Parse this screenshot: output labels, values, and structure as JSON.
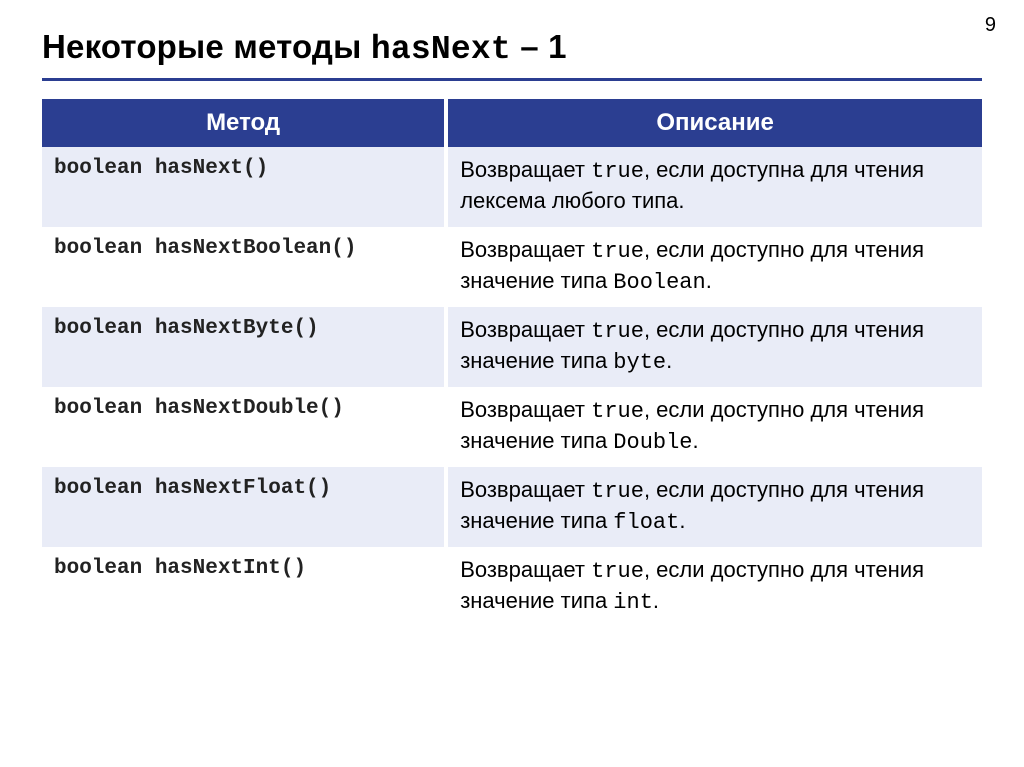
{
  "page_number": "9",
  "title_prefix": "Некоторые методы ",
  "title_code": "hasNext",
  "title_suffix": " – 1",
  "headers": {
    "method": "Метод",
    "description": "Описание"
  },
  "rows": [
    {
      "method": "boolean hasNext()",
      "desc_a": "Возвращает ",
      "desc_code1": "true",
      "desc_b": ", если доступна для чтения лексема любого типа.",
      "desc_code2": "",
      "desc_c": ""
    },
    {
      "method": "boolean hasNextBoolean()",
      "desc_a": "Возвращает ",
      "desc_code1": "true",
      "desc_b": ", если доступно для чтения значение типа ",
      "desc_code2": "Boolean",
      "desc_c": "."
    },
    {
      "method": "boolean hasNextByte()",
      "desc_a": "Возвращает ",
      "desc_code1": "true",
      "desc_b": ", если доступно для чтения значение типа ",
      "desc_code2": "byte",
      "desc_c": "."
    },
    {
      "method": "boolean hasNextDouble()",
      "desc_a": "Возвращает ",
      "desc_code1": "true",
      "desc_b": ", если доступно для чтения значение типа ",
      "desc_code2": "Double",
      "desc_c": "."
    },
    {
      "method": "boolean hasNextFloat()",
      "desc_a": "Возвращает ",
      "desc_code1": "true",
      "desc_b": ", если доступно для чтения значение типа ",
      "desc_code2": "float",
      "desc_c": "."
    },
    {
      "method": "boolean hasNextInt()",
      "desc_a": "Возвращает ",
      "desc_code1": "true",
      "desc_b": ", если доступно для чтения значение типа ",
      "desc_code2": "int",
      "desc_c": "."
    }
  ]
}
